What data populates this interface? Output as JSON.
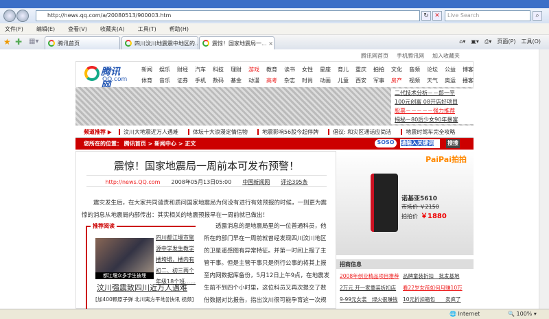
{
  "browser": {
    "url": "http://news.qq.com/a/20080513/900003.htm",
    "search_placeholder": "Live Search",
    "menu": [
      "文件(F)",
      "编辑(E)",
      "查看(V)",
      "收藏夹(A)",
      "工具(T)",
      "帮助(H)"
    ],
    "tabs": [
      "腾讯首页",
      "四川汶川地震震中地区的...",
      "震惊！国家地震局一..."
    ],
    "tools": {
      "page": "页面(P)",
      "tools": "工具(O)"
    },
    "status": {
      "zone": "Internet",
      "zoom": "100%"
    }
  },
  "site": {
    "top_links": [
      "腾讯网首页",
      "手机腾讯网",
      "加入收藏夹"
    ],
    "logo": {
      "name": "腾讯网",
      "domain": "QQ.com"
    },
    "nav_row1": [
      "新闻",
      "娱乐",
      "财经",
      "汽车",
      "科技",
      "理财",
      "游戏",
      "教育",
      "读书",
      "女性",
      "星座",
      "育儿",
      "重庆",
      "拍拍",
      "文化",
      "音频",
      "论坛",
      "公益",
      "博客"
    ],
    "nav_row2": [
      "体育",
      "音乐",
      "证券",
      "手机",
      "数码",
      "基金",
      "动漫",
      "高考",
      "杂志",
      "时尚",
      "动画",
      "儿童",
      "西安",
      "军事",
      "房产",
      "视频",
      "天气",
      "奥运",
      "播客"
    ],
    "ad_links": [
      "二代技术分析－－郎一平",
      "100元创富 08开店好项目",
      "股票－－－－－强力推荐",
      "揭秘－80后少女90年暴富"
    ],
    "rec_label": "频道推荐 ▶",
    "rec_items": [
      "汶川大地震近万人遇难",
      "体坛十大浪漫定情信物",
      "地震影响56股今起停牌",
      "倡议: 和灾区通话应简洁",
      "地震时驾车完全攻略"
    ],
    "location": "您所在的位置： 腾讯首页 > 新闻中心 > 正文",
    "soso": "SOSO",
    "search_value": "请输入关键词",
    "search_btn": "搜搜"
  },
  "article": {
    "title": "震惊！国家地震局一周前本可发布预警！",
    "source_url": "http://news.QQ.com",
    "date": "2008年05月13日05:00",
    "source": "中国新闻网",
    "comments": "评论395条",
    "p1": "震灾发生后，在大家共同谴责和质问国家地震局为何没有进行有效预报的时候，一则更为震惊的消息从地震局内部传出：其实相关的地震预报早在一周前就已做出！",
    "p2": "透露消息的是地震局里的一位普通科员，他所在的部门早在一周前就曾经发现四川汶川地区的卫星遥感图有异常特征。并第一时间上报了主管干事。但是主管干事只是例行公事的将其上报至内网数据库备份，5月12日上午9点，在地震发生前不到四个小时里，这位科员又再次提交了数份数据对比报告，指出汶川很可能孕育这一次规模巨大的地质活动。领导批评"
  },
  "recommend": {
    "label": "推荐阅读",
    "caption": "都江堰众多学生被埋",
    "text": "四川都江堰市聚源中学发生教学楼垮塌，楼内有初二、初三两个年级18个班……",
    "headline": "汶川强震致四川近万人遇难",
    "sublinks": "[加400颗原子弹  北川离方平地][快讯 视频]"
  },
  "sidebar": {
    "brand": "PaiPai拍拍",
    "phone": "诺基亚5610",
    "market_price": "市场价 ￥2150",
    "pp_label": "拍拍价",
    "pp_price": "￥1880",
    "zs_title": "招商信息",
    "zs_links": [
      "2008年创业精品项目推荐",
      "品牌童装折扣　批发基地",
      "2万元 开一家童装折扣店",
      "看22岁女孩如何月赚10万",
      "9-99元女装　绿火很赚钱",
      "10元折扣箱包　　卖疯了"
    ]
  }
}
